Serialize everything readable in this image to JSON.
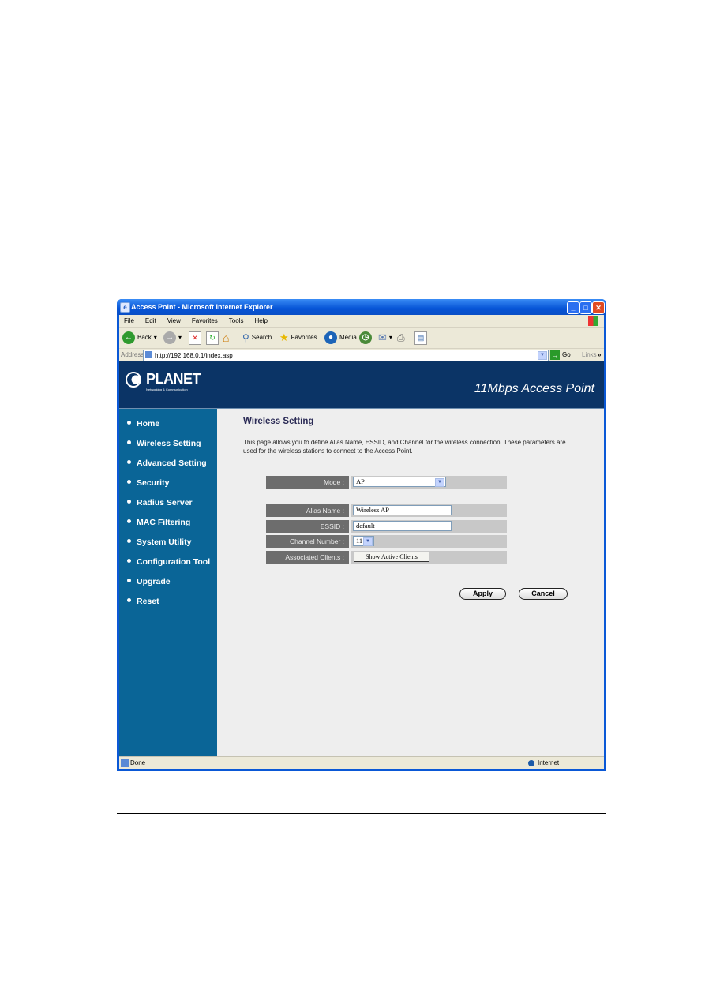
{
  "window": {
    "title": "Access Point - Microsoft Internet Explorer"
  },
  "menu": [
    "File",
    "Edit",
    "View",
    "Favorites",
    "Tools",
    "Help"
  ],
  "toolbar": {
    "back": "Back",
    "search": "Search",
    "favorites": "Favorites",
    "media": "Media"
  },
  "address": {
    "label": "Address",
    "url": "http://192.168.0.1/index.asp",
    "go": "Go",
    "links": "Links"
  },
  "header": {
    "logo": "PLANET",
    "logo_sub": "Networking & Communication",
    "product": "11Mbps Access Point"
  },
  "sidebar": {
    "items": [
      {
        "label": "Home"
      },
      {
        "label": "Wireless Setting"
      },
      {
        "label": "Advanced Setting"
      },
      {
        "label": "Security"
      },
      {
        "label": "Radius Server"
      },
      {
        "label": "MAC Filtering"
      },
      {
        "label": "System Utility"
      },
      {
        "label": "Configuration Tool"
      },
      {
        "label": "Upgrade"
      },
      {
        "label": "Reset"
      }
    ]
  },
  "main": {
    "title": "Wireless Setting",
    "description": "This page allows you to define Alias Name, ESSID, and Channel for the wireless connection. These parameters are used for the wireless stations to connect to the Access Point.",
    "mode": {
      "label": "Mode :",
      "value": "AP"
    },
    "alias": {
      "label": "Alias Name :",
      "value": "Wireless AP"
    },
    "essid": {
      "label": "ESSID :",
      "value": "default"
    },
    "channel": {
      "label": "Channel Number :",
      "value": "11"
    },
    "clients": {
      "label": "Associated Clients :",
      "button": "Show Active Clients"
    },
    "apply": "Apply",
    "cancel": "Cancel"
  },
  "status": {
    "text": "Done",
    "zone": "Internet"
  },
  "colors": {
    "header": "#0b3466",
    "sidebar": "#0a6597",
    "label_bg": "#6d6d6d",
    "value_bg": "#c8c8c8"
  }
}
